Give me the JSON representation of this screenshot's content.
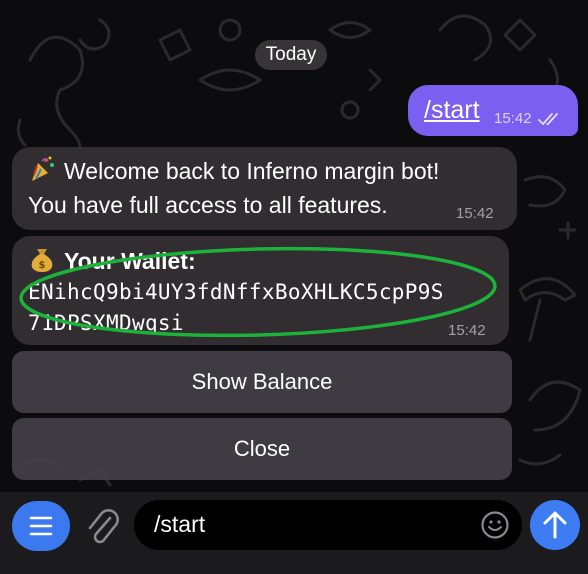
{
  "chat": {
    "date_label": "Today",
    "outgoing": {
      "text": "/start",
      "time": "15:42",
      "status": "read"
    },
    "welcome": {
      "emoji": "party-popper",
      "line1": "Welcome back to Inferno margin bot!",
      "line2": "You have full access to all features.",
      "time": "15:42"
    },
    "wallet": {
      "emoji": "money-bag",
      "title": "Your Wallet:",
      "address_line1": "ENihcQ9bi4UY3fdNffxBoXHLKC5cpP9S",
      "address_line2": "71DPSXMDwqsi",
      "time": "15:42",
      "highlight_color": "#1db33a"
    }
  },
  "keyboard": {
    "buttons": [
      "Show Balance",
      "Close"
    ]
  },
  "composer": {
    "text": "/start",
    "accent": "#3d7bf2"
  },
  "colors": {
    "outgoing_bubble": "#7a5ff0",
    "incoming_bubble": "#343034",
    "background": "#0c0c0e"
  }
}
